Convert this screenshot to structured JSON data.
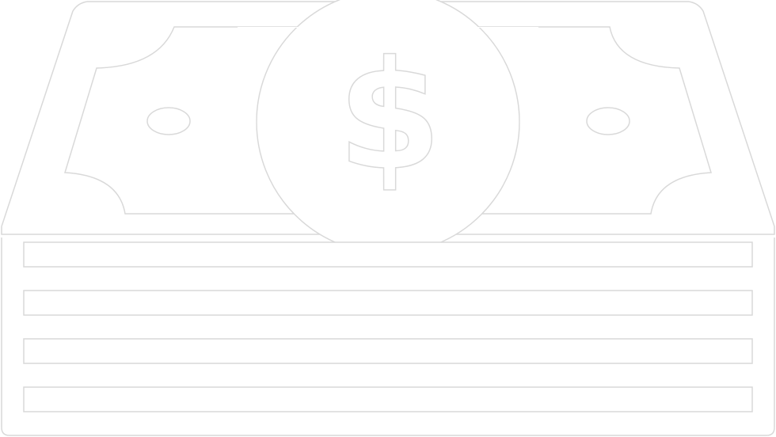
{
  "icon": {
    "name": "money-stack-icon",
    "symbol": "$",
    "fill_color": "#ffffff",
    "outline_color": "#d9d9d9"
  }
}
